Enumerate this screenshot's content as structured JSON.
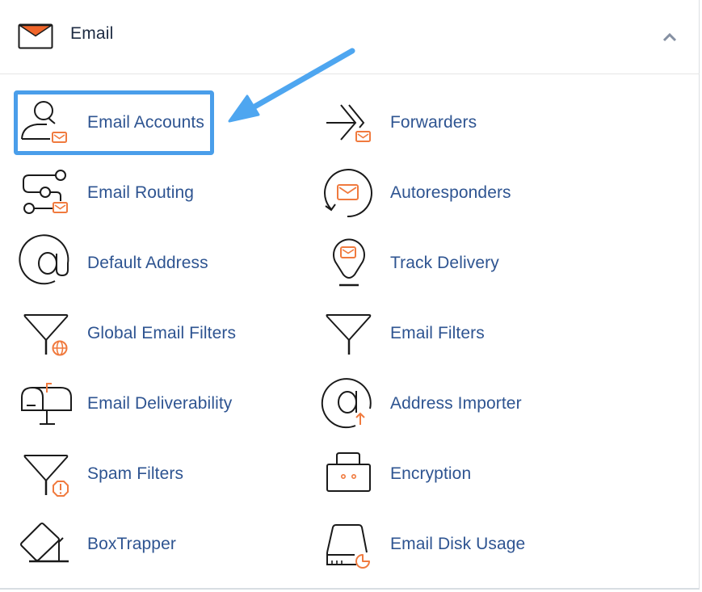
{
  "section": {
    "title": "Email",
    "icon": "envelope-icon",
    "collapse_icon": "chevron-up-icon",
    "expanded": true
  },
  "colors": {
    "link_text": "#2e5491",
    "title_text": "#1d2b42",
    "icon_accent": "#f07a3e",
    "highlight": "#4a9eea"
  },
  "items": [
    {
      "label": "Email Accounts",
      "icon": "user-envelope-icon",
      "column": 1,
      "highlighted": true
    },
    {
      "label": "Forwarders",
      "icon": "forward-arrow-envelope-icon",
      "column": 2
    },
    {
      "label": "Email Routing",
      "icon": "routing-nodes-envelope-icon",
      "column": 1
    },
    {
      "label": "Autoresponders",
      "icon": "circular-arrow-envelope-icon",
      "column": 2
    },
    {
      "label": "Default Address",
      "icon": "at-sign-icon",
      "column": 1
    },
    {
      "label": "Track Delivery",
      "icon": "location-pin-envelope-icon",
      "column": 2
    },
    {
      "label": "Global Email Filters",
      "icon": "funnel-globe-icon",
      "column": 1
    },
    {
      "label": "Email Filters",
      "icon": "funnel-icon",
      "column": 2
    },
    {
      "label": "Email Deliverability",
      "icon": "mailbox-icon",
      "column": 1
    },
    {
      "label": "Address Importer",
      "icon": "at-sign-upload-icon",
      "column": 2
    },
    {
      "label": "Spam Filters",
      "icon": "funnel-warning-icon",
      "column": 1
    },
    {
      "label": "Encryption",
      "icon": "lock-box-icon",
      "column": 2
    },
    {
      "label": "BoxTrapper",
      "icon": "box-trap-icon",
      "column": 1
    },
    {
      "label": "Email Disk Usage",
      "icon": "disk-usage-icon",
      "column": 2
    }
  ],
  "annotation": {
    "type": "arrow",
    "target": "Email Accounts"
  }
}
